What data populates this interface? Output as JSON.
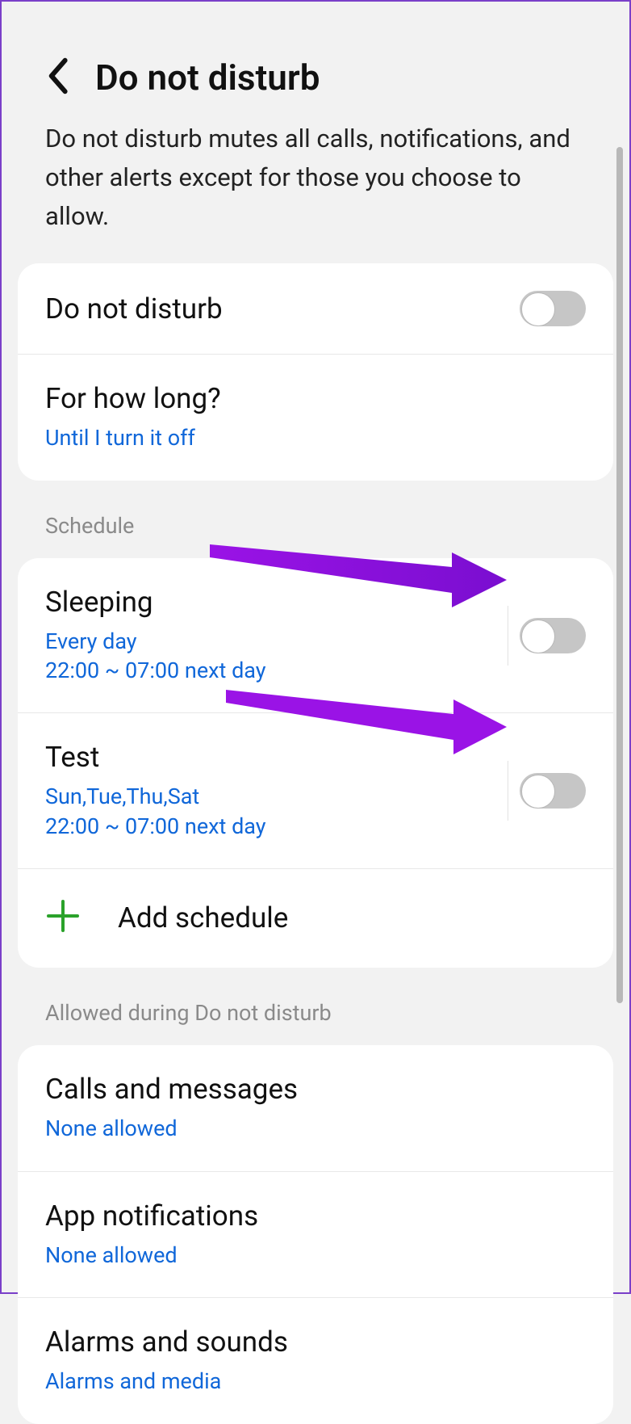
{
  "header": {
    "title": "Do not disturb"
  },
  "description": "Do not disturb mutes all calls, notifications, and other alerts except for those you choose to allow.",
  "main": {
    "dnd_label": "Do not disturb",
    "duration_label": "For how long?",
    "duration_value": "Until I turn it off"
  },
  "sections": {
    "schedule_header": "Schedule",
    "allowed_header": "Allowed during Do not disturb"
  },
  "schedules": [
    {
      "name": "Sleeping",
      "days": "Every day",
      "time": "22:00 ~ 07:00 next day"
    },
    {
      "name": "Test",
      "days": "Sun,Tue,Thu,Sat",
      "time": "22:00 ~ 07:00 next day"
    }
  ],
  "add_schedule_label": "Add schedule",
  "allowed": [
    {
      "title": "Calls and messages",
      "sub": "None allowed"
    },
    {
      "title": "App notifications",
      "sub": "None allowed"
    },
    {
      "title": "Alarms and sounds",
      "sub": "Alarms and media"
    }
  ],
  "colors": {
    "accent": "#1067d9",
    "plus": "#2aa22a",
    "annotation": "#9a13e6"
  }
}
